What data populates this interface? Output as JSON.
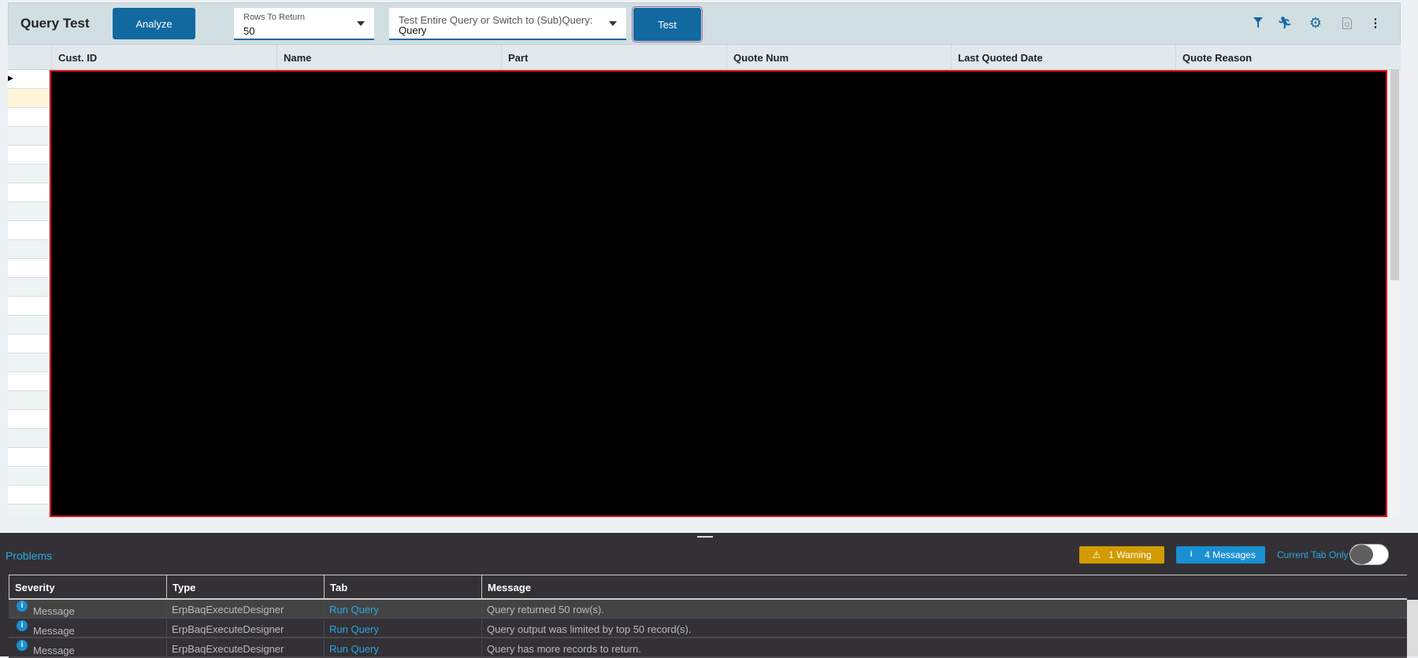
{
  "toolbar": {
    "title": "Query Test",
    "analyze": "Analyze",
    "rows_label": "Rows To Return",
    "rows_value": "50",
    "query_label": "Test Entire Query or Switch to (Sub)Query:",
    "query_value": "Query",
    "test": "Test",
    "icons": [
      "filter-icon",
      "run-icon",
      "gear-icon",
      "document-icon",
      "more-icon"
    ]
  },
  "grid": {
    "columns": [
      "Cust. ID",
      "Name",
      "Part",
      "Quote Num",
      "Last Quoted Date",
      "Quote Reason"
    ]
  },
  "problems": {
    "title": "Problems",
    "warning_badge": "1 Warning",
    "messages_badge": "4 Messages",
    "current_tab_only": "Current Tab Only",
    "current_tab_only_on": false,
    "columns": [
      "Severity",
      "Type",
      "Tab",
      "Message"
    ],
    "rows": [
      {
        "severity": "Message",
        "type": "ErpBaqExecuteDesigner",
        "tab": "Run Query",
        "message": "Query returned 50 row(s)."
      },
      {
        "severity": "Message",
        "type": "ErpBaqExecuteDesigner",
        "tab": "Run Query",
        "message": "Query output was limited by top 50 record(s)."
      },
      {
        "severity": "Message",
        "type": "ErpBaqExecuteDesigner",
        "tab": "Run Query",
        "message": "Query has more records to return."
      }
    ]
  },
  "colors": {
    "accent": "#1169a0",
    "warning": "#d29b00",
    "info": "#1a8fd1",
    "link": "#2aa8e0"
  }
}
